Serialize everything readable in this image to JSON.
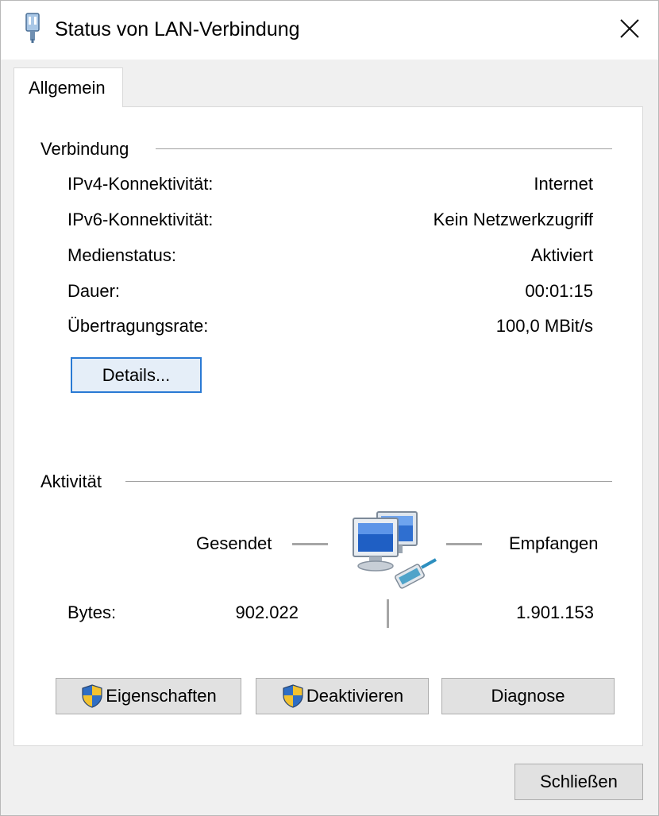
{
  "window": {
    "title": "Status von LAN-Verbindung",
    "title_icon": "network-adapter-icon",
    "close_icon": "close-icon"
  },
  "tabs": [
    {
      "label": "Allgemein",
      "selected": true
    }
  ],
  "connection": {
    "section_label": "Verbindung",
    "rows": [
      {
        "label": "IPv4-Konnektivität:",
        "value": "Internet"
      },
      {
        "label": "IPv6-Konnektivität:",
        "value": "Kein Netzwerkzugriff"
      },
      {
        "label": "Medienstatus:",
        "value": "Aktiviert"
      },
      {
        "label": "Dauer:",
        "value": "00:01:15"
      },
      {
        "label": "Übertragungsrate:",
        "value": "100,0 MBit/s"
      }
    ],
    "details_button": "Details..."
  },
  "activity": {
    "section_label": "Aktivität",
    "sent_label": "Gesendet",
    "received_label": "Empfangen",
    "bytes_label": "Bytes:",
    "bytes_sent": "902.022",
    "bytes_received": "1.901.153",
    "icon": "network-computers-icon"
  },
  "actions": {
    "properties": "Eigenschaften",
    "deactivate": "Deaktivieren",
    "diagnose": "Diagnose",
    "close": "Schließen",
    "shield_icon": "uac-shield-icon"
  },
  "colors": {
    "focus_border": "#2a7ad4",
    "button_face": "#e1e1e1",
    "dialog_background": "#f0f0f0"
  }
}
